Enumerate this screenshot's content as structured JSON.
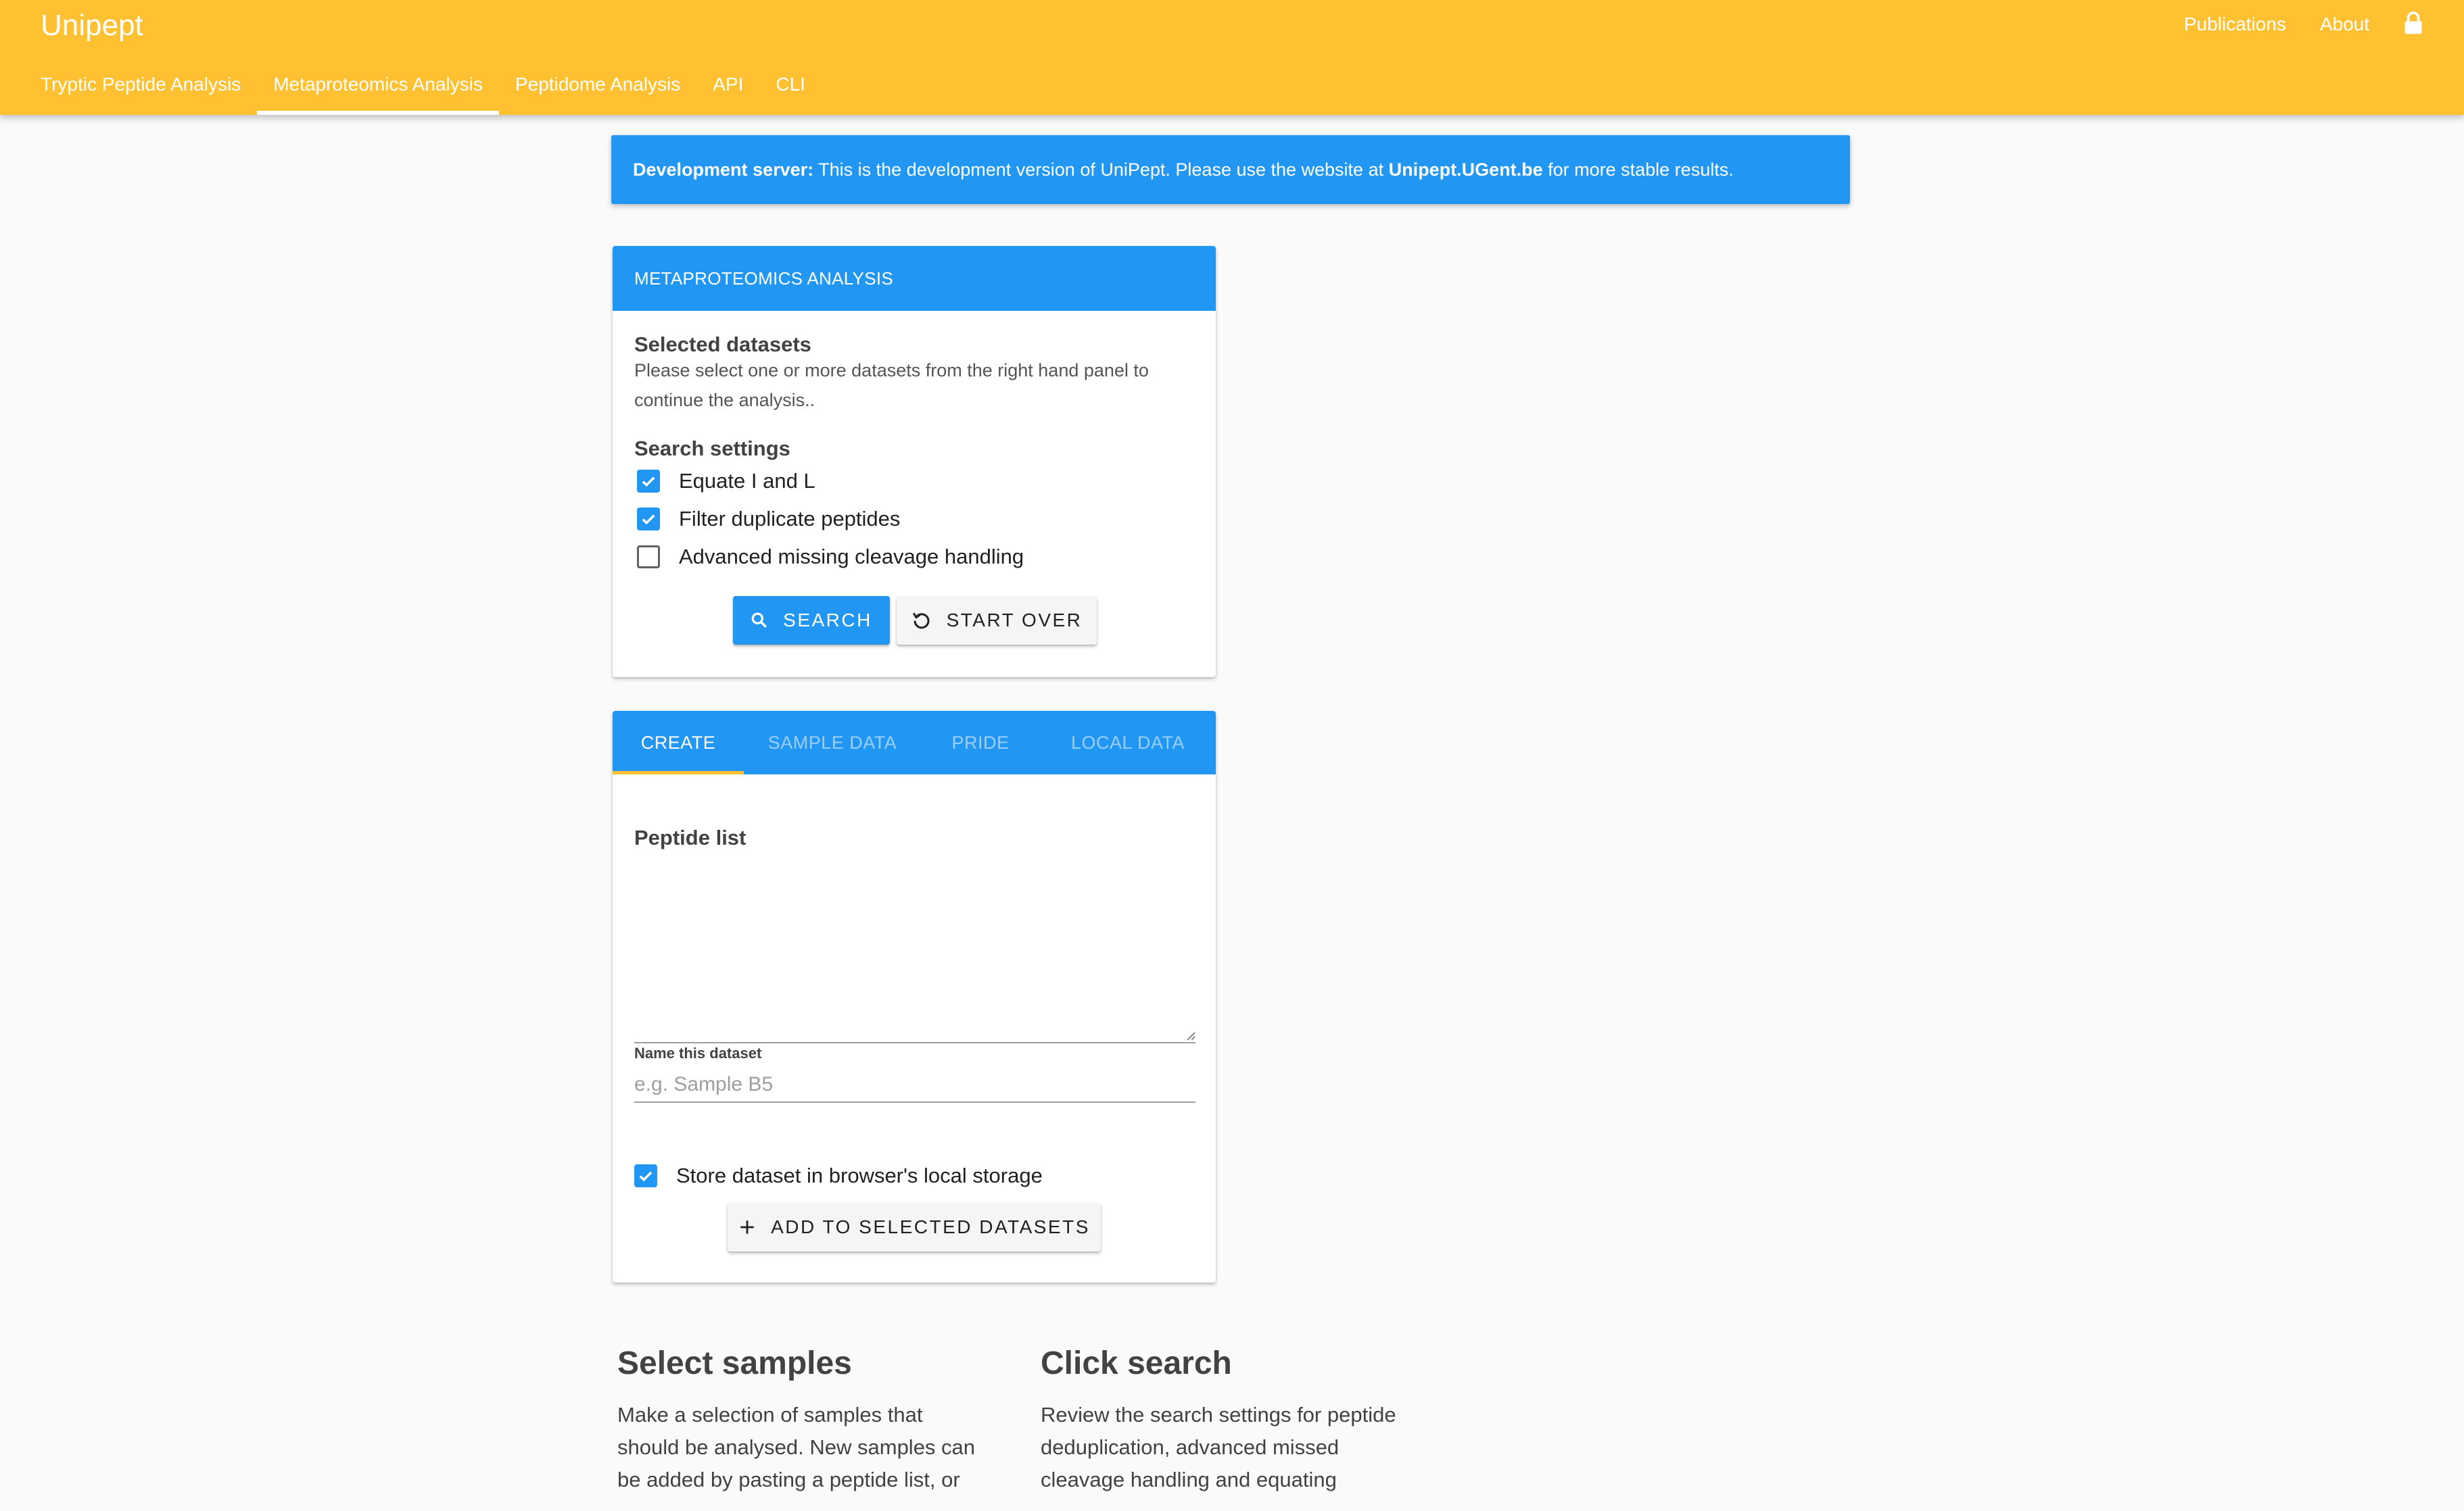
{
  "app": {
    "title": "Unipept"
  },
  "top_links": [
    "Publications",
    "About"
  ],
  "nav": {
    "tabs": [
      {
        "label": "Tryptic Peptide Analysis"
      },
      {
        "label": "Metaproteomics Analysis",
        "active": true
      },
      {
        "label": "Peptidome Analysis"
      },
      {
        "label": "API"
      },
      {
        "label": "CLI"
      }
    ]
  },
  "banner": {
    "bold": "Development server:",
    "text1": " This is the development version of UniPept. Please use the website at ",
    "link": "Unipept.UGent.be",
    "text2": " for more stable results."
  },
  "analysis": {
    "header": "Metaproteomics Analysis",
    "selected_title": "Selected datasets",
    "selected_text": "Please select one or more datasets from the right hand panel to continue the analysis..",
    "settings_title": "Search settings",
    "settings": [
      {
        "label": "Equate I and L",
        "checked": true
      },
      {
        "label": "Filter duplicate peptides",
        "checked": true
      },
      {
        "label": "Advanced missing cleavage handling",
        "checked": false
      }
    ],
    "search_button": "Search",
    "start_over_button": "Start over"
  },
  "create": {
    "tabs": [
      {
        "label": "Create",
        "active": true
      },
      {
        "label": "Sample data"
      },
      {
        "label": "Pride"
      },
      {
        "label": "Local data"
      }
    ],
    "peptide_list_label": "Peptide list",
    "name_label": "Name this dataset",
    "name_placeholder": "e.g. Sample B5",
    "store_label": "Store dataset in browser's local storage",
    "store_checked": true,
    "add_button": "Add to selected datasets"
  },
  "info": [
    {
      "title": "Select samples",
      "text": "Make a selection of samples that should be analysed. New samples can be added by pasting a peptide list, or"
    },
    {
      "title": "Click search",
      "text": "Review the search settings for peptide deduplication, advanced missed cleavage handling and equating"
    }
  ],
  "colors": {
    "toolbar": "#ffc132",
    "primary": "#2196f3",
    "tab_indicator": "#ffc132"
  },
  "icons": [
    "lock-icon",
    "search-icon",
    "restart-icon",
    "plus-icon",
    "check-icon",
    "resize-handle-icon"
  ]
}
